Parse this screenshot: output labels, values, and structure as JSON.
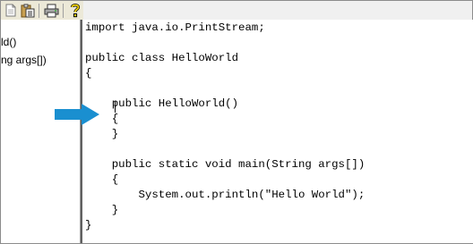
{
  "toolbar": {
    "buttons": [
      {
        "icon": "document-icon"
      },
      {
        "icon": "clipboard-paste-icon"
      },
      {
        "icon": "printer-icon"
      },
      {
        "icon": "help-question-icon"
      }
    ]
  },
  "sidebar": {
    "items": [
      {
        "label": "ld()"
      },
      {
        "label": "ng args[])"
      }
    ]
  },
  "editor": {
    "lines": [
      "import java.io.PrintStream;",
      "",
      "public class HelloWorld",
      "{",
      "",
      "    public HelloWorld()",
      "    {",
      "    }",
      "",
      "    public static void main(String args[])",
      "    {",
      "        System.out.println(\"Hello World\");",
      "    }",
      "}"
    ]
  },
  "annotation": {
    "icon": "blue-arrow-icon",
    "color": "#1a8fd0"
  }
}
